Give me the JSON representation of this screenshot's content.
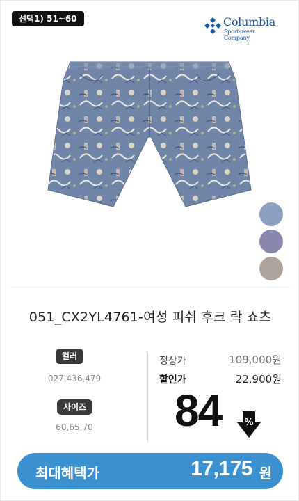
{
  "selection_badge": "선택1) 51~60",
  "brand": {
    "name": "Columbia",
    "sub": "Sportswear Company",
    "color": "#1a56a8"
  },
  "product": {
    "name": "051_CX2YL4761-여성 피쉬 후크 락 쇼츠",
    "image_icon": "patterned-shorts-image",
    "fabric_color": "#6f86a8"
  },
  "swatches": [
    {
      "color": "#8d9fc0"
    },
    {
      "color": "#8a88ad"
    },
    {
      "color": "#aea39a"
    }
  ],
  "meta": {
    "color_label": "컬러",
    "color_value": "027,436,479",
    "size_label": "사이즈",
    "size_value": "60,65,70"
  },
  "pricing": {
    "regular_label": "정상가",
    "regular_price": "109,000원",
    "sale_label": "할인가",
    "sale_price": "22,900원",
    "discount_rate": "84",
    "discount_icon": "percent-down-arrow-icon"
  },
  "benefit": {
    "label": "최대혜택가",
    "price": "17,175",
    "unit": "원",
    "color": "#3b91cf"
  }
}
